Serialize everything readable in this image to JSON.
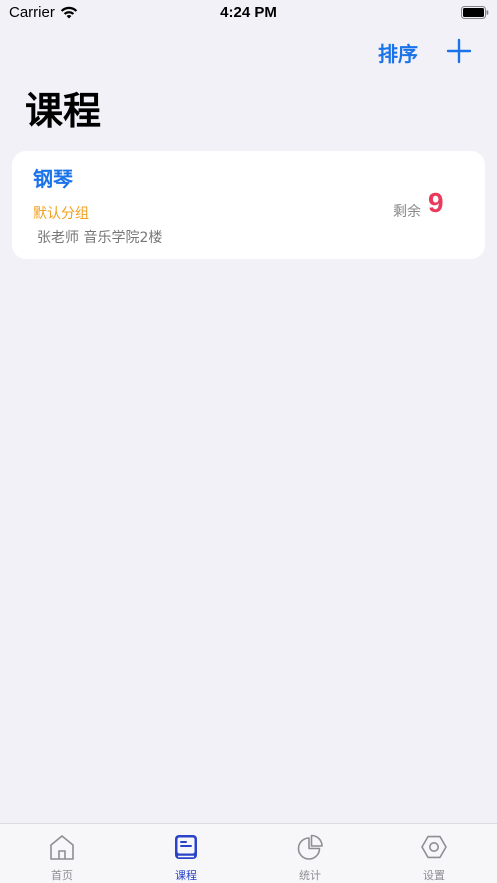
{
  "status_bar": {
    "carrier": "Carrier",
    "time": "4:24 PM"
  },
  "nav": {
    "sort_label": "排序",
    "add_icon": "plus-icon"
  },
  "page": {
    "title": "课程"
  },
  "courses": [
    {
      "name": "钢琴",
      "group": "默认分组",
      "meta": "张老师 音乐学院2楼",
      "remaining_label": "剩余",
      "remaining_count": "9"
    }
  ],
  "tabs": [
    {
      "label": "首页",
      "icon": "home-icon",
      "active": false
    },
    {
      "label": "课程",
      "icon": "book-icon",
      "active": true
    },
    {
      "label": "统计",
      "icon": "pie-chart-icon",
      "active": false
    },
    {
      "label": "设置",
      "icon": "settings-icon",
      "active": false
    }
  ],
  "colors": {
    "accent": "#1A73E8",
    "group": "#F0A020",
    "remaining": "#EA3A5C",
    "tab_active": "#2A43C8",
    "background": "#F2F1F7"
  }
}
